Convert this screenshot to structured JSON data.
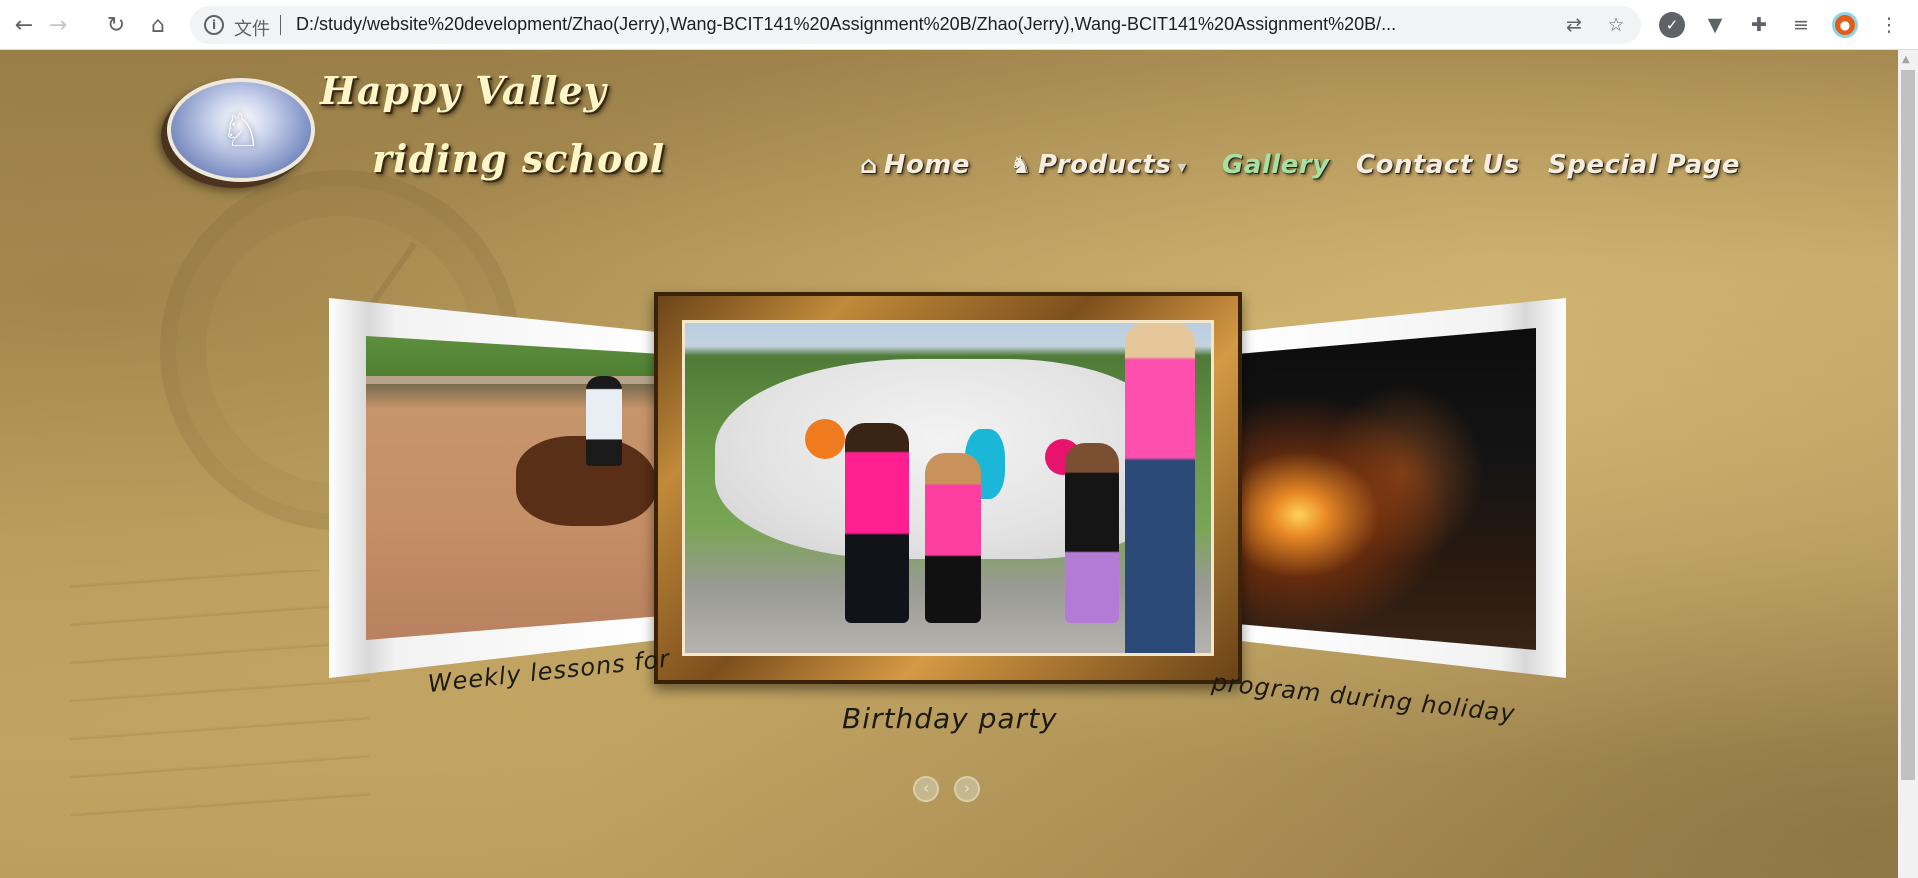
{
  "browser": {
    "url": "D:/study/website%20development/Zhao(Jerry),Wang-BCIT141%20Assignment%20B/Zhao(Jerry),Wang-BCIT141%20Assignment%20B/...",
    "file_label": "文件",
    "icons": {
      "back": "arrow-left-icon",
      "forward": "arrow-right-icon",
      "reload": "reload-icon",
      "home": "home-icon",
      "translate": "translate-icon",
      "bookmark": "star-icon",
      "extensions": "puzzle-icon",
      "media": "media-queue-icon",
      "menu": "kebab-menu-icon"
    }
  },
  "site": {
    "brand_line1": "Happy Valley",
    "brand_line2": "riding school",
    "nav": [
      {
        "label": "Home",
        "icon": "home-icon"
      },
      {
        "label": "Products",
        "icon": "horse-icon",
        "has_dropdown": true
      },
      {
        "label": "Gallery",
        "active": true
      },
      {
        "label": "Contact Us"
      },
      {
        "label": "Special Page"
      }
    ],
    "active_color": "#a6e0a2"
  },
  "carousel": {
    "left_caption": "Weekly lessons for",
    "center_caption": "Birthday party",
    "right_caption": "program during holiday",
    "prev_icon": "chevron-left-icon",
    "next_icon": "chevron-right-icon"
  },
  "glyphs": {
    "back": "←",
    "forward": "→",
    "reload": "↻",
    "home": "⌂",
    "info": "i",
    "translate": "⇄",
    "star": "☆",
    "puzzle": "✚",
    "media": "≡",
    "menu": "⋮",
    "nav_home": "⌂",
    "nav_horse": "♞",
    "caret": "▾",
    "prev": "‹",
    "next": "›",
    "logo": "♘"
  }
}
